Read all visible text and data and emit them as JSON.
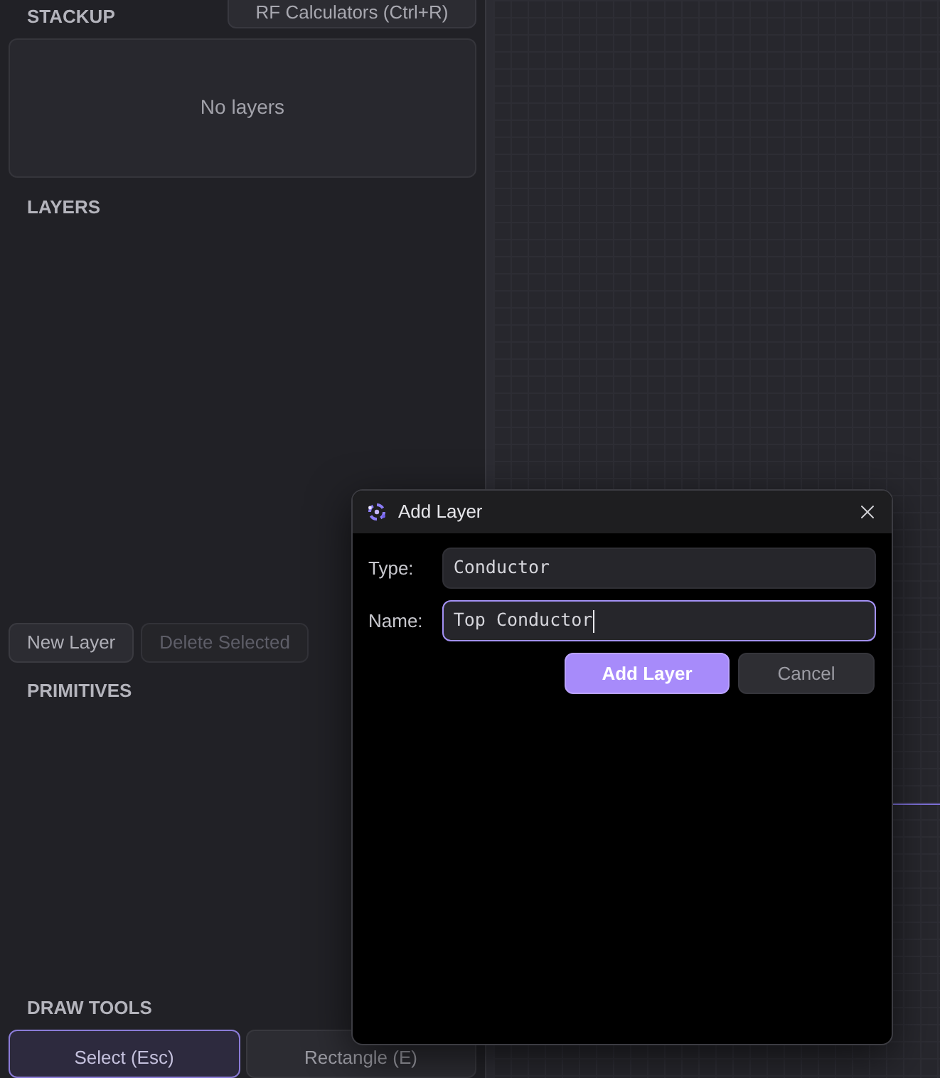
{
  "left_panel": {
    "stackup": {
      "title": "STACKUP",
      "rf_button": "RF Calculators (Ctrl+R)",
      "empty_text": "No layers"
    },
    "layers": {
      "title": "LAYERS",
      "buttons": [
        {
          "label": "New Layer",
          "disabled": false
        },
        {
          "label": "Delete Selected",
          "disabled": true
        }
      ]
    },
    "primitives": {
      "title": "PRIMITIVES"
    },
    "draw_tools": {
      "title": "DRAW TOOLS",
      "tools": [
        {
          "label": "Select (Esc)",
          "selected": true
        },
        {
          "label": "Rectangle (E)",
          "selected": false
        }
      ]
    }
  },
  "dialog": {
    "title": "Add Layer",
    "fields": [
      {
        "label": "Type:",
        "value": "Conductor",
        "focused": false
      },
      {
        "label": "Name:",
        "value": "Top Conductor",
        "focused": true
      }
    ],
    "buttons": [
      {
        "label": "Add Layer",
        "kind": "primary"
      },
      {
        "label": "Cancel",
        "kind": "secondary"
      }
    ]
  }
}
